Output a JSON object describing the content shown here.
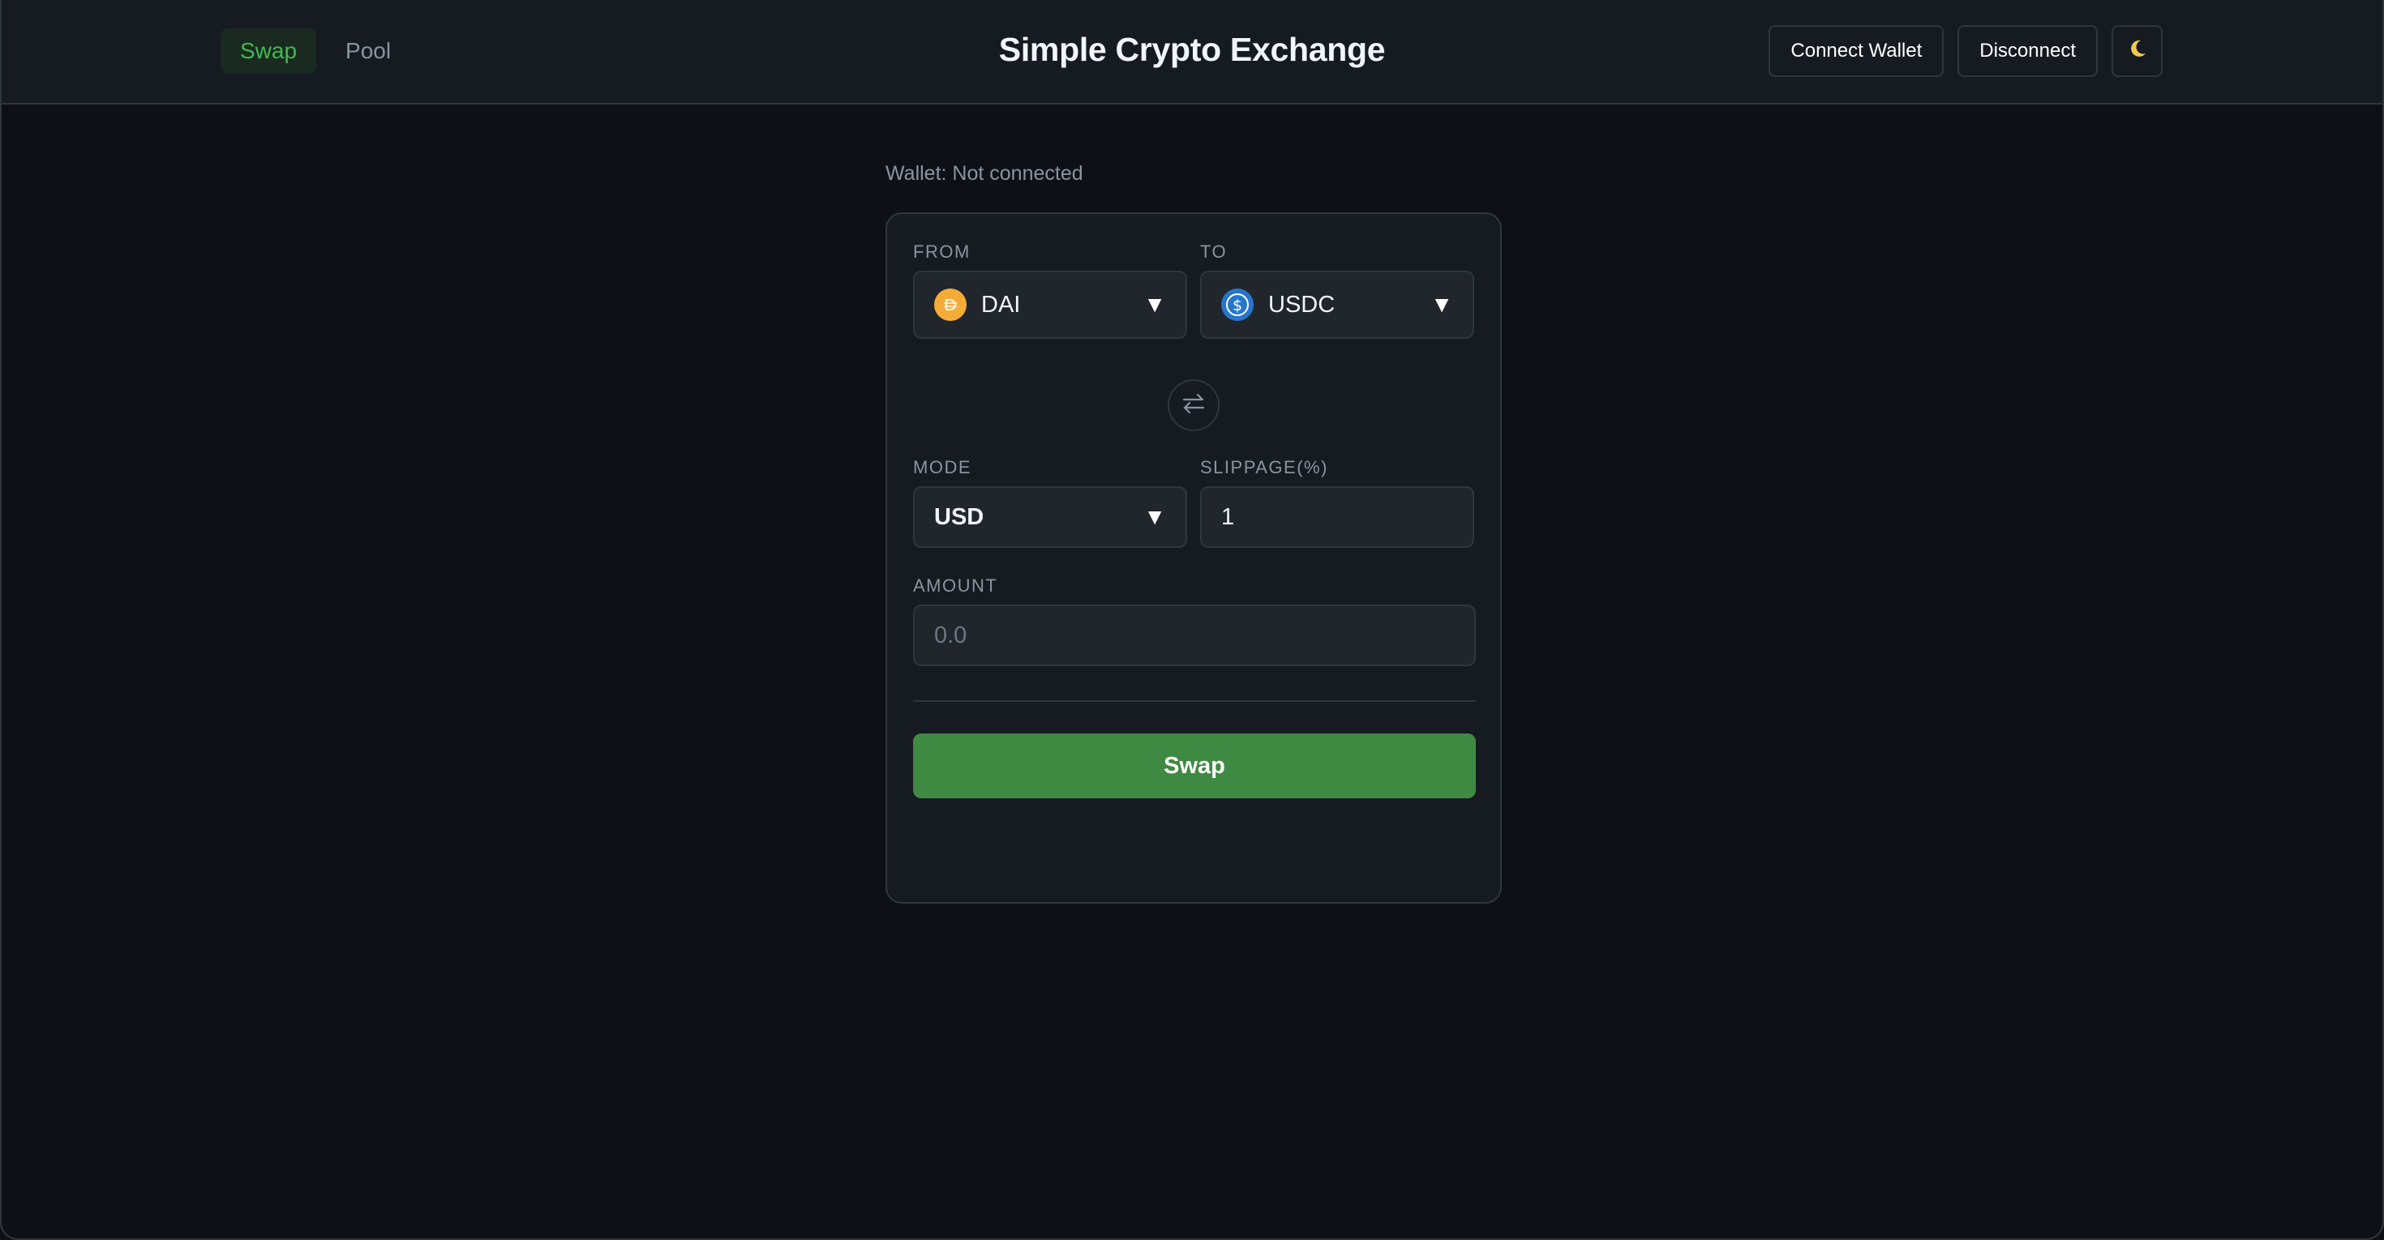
{
  "header": {
    "tabs": [
      {
        "label": "Swap",
        "active": true
      },
      {
        "label": "Pool",
        "active": false
      }
    ],
    "title": "Simple Crypto Exchange",
    "connect_label": "Connect Wallet",
    "disconnect_label": "Disconnect",
    "theme_icon": "moon-icon"
  },
  "wallet": {
    "status_text": "Wallet: Not connected"
  },
  "swap_form": {
    "from_label": "FROM",
    "from_token": "DAI",
    "from_icon": "dai-coin-icon",
    "to_label": "TO",
    "to_token": "USDC",
    "to_icon": "usdc-coin-icon",
    "switch_icon": "swap-arrows-icon",
    "mode_label": "MODE",
    "mode_value": "USD",
    "slippage_label": "SLIPPAGE(%)",
    "slippage_value": "1",
    "amount_label": "AMOUNT",
    "amount_placeholder": "0.0",
    "submit_label": "Swap"
  },
  "colors": {
    "background": "#0d1117",
    "surface": "#161b22",
    "accent_green": "#3f8a42",
    "active_tab_text": "#3fb950",
    "dai_yellow": "#f5ac37",
    "usdc_blue": "#2775ca"
  }
}
